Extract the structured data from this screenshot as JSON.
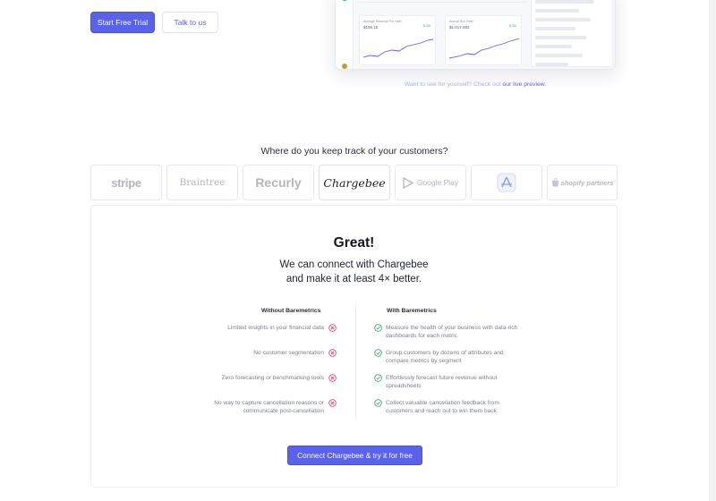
{
  "hero": {
    "primary_button": "Start Free Trial",
    "secondary_button": "Talk to us"
  },
  "preview": {
    "card1_label": "Average Revenue Per User",
    "card1_value": "$156.15",
    "card1_change": "5.3%",
    "card2_label": "Annual Run Rate",
    "card2_value": "$1,017,982",
    "card2_change": "8.3%"
  },
  "live_preview_note": {
    "text": "Want to see for yourself? Check out",
    "link": "our live preview."
  },
  "integrations": {
    "question": "Where do you keep track of your customers?",
    "providers": [
      {
        "label": "stripe",
        "selected": false
      },
      {
        "label": "Braintree",
        "selected": false
      },
      {
        "label": "Recurly",
        "selected": false
      },
      {
        "label": "Chargebee",
        "selected": true
      },
      {
        "label": "Google Play",
        "selected": false
      },
      {
        "label": "App Store icon",
        "selected": false
      },
      {
        "label": "shopify partners",
        "selected": false
      }
    ]
  },
  "panel": {
    "title": "Great!",
    "subtitle_line1": "We can connect with Chargebee",
    "subtitle_line2": "and make it at least 4× better.",
    "without_heading": "Without Baremetrics",
    "with_heading": "With Baremetrics",
    "without_items": [
      [
        "Limited insights in your financial data"
      ],
      [
        "No customer segmentation"
      ],
      [
        "Zero forecasting or benchmarking tools"
      ],
      [
        "No way to capture cancellation reasons or",
        "communicate post-cancellation"
      ]
    ],
    "with_items": [
      [
        "Measure the health of your business with data-rich",
        "dashboards for each metric"
      ],
      [
        "Group customers by dozens of attributes and",
        "compare metrics by segment"
      ],
      [
        "Effortlessly forecast future revenue without",
        "spreadsheets"
      ],
      [
        "Collect valuable cancellation feedback from",
        "customers and reach out to win them back"
      ]
    ],
    "cta": "Connect Chargebee & try it for free"
  },
  "colors": {
    "accent": "#5b62ea",
    "negative": "#e0457b",
    "positive": "#2fae6d"
  }
}
